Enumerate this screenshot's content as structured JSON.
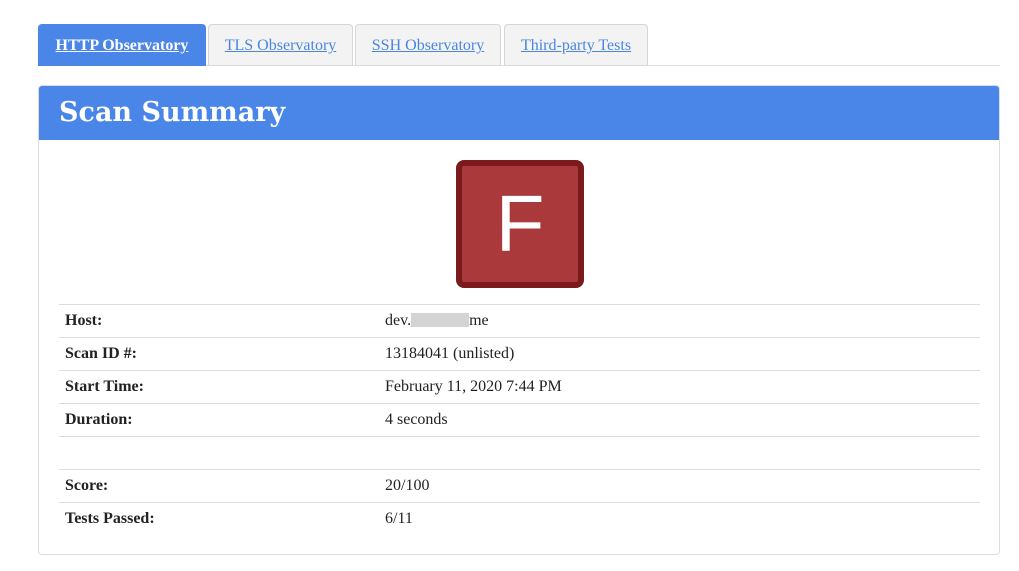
{
  "tabs": [
    {
      "label": "HTTP Observatory",
      "active": true
    },
    {
      "label": "TLS Observatory",
      "active": false
    },
    {
      "label": "SSH Observatory",
      "active": false
    },
    {
      "label": "Third-party Tests",
      "active": false
    }
  ],
  "panel": {
    "title": "Scan Summary",
    "grade": "F",
    "grade_color": "#a9393a",
    "grade_border_color": "#7a1a1c"
  },
  "summary": {
    "host_label": "Host:",
    "host_prefix": "dev.",
    "host_suffix": "me",
    "scan_id_label": "Scan ID #:",
    "scan_id_value": "13184041 (unlisted)",
    "start_time_label": "Start Time:",
    "start_time_value": "February 11, 2020 7:44 PM",
    "duration_label": "Duration:",
    "duration_value": "4 seconds",
    "score_label": "Score:",
    "score_value": "20/100",
    "tests_passed_label": "Tests Passed:",
    "tests_passed_value": "6/11"
  },
  "colors": {
    "accent": "#4a86e8"
  }
}
